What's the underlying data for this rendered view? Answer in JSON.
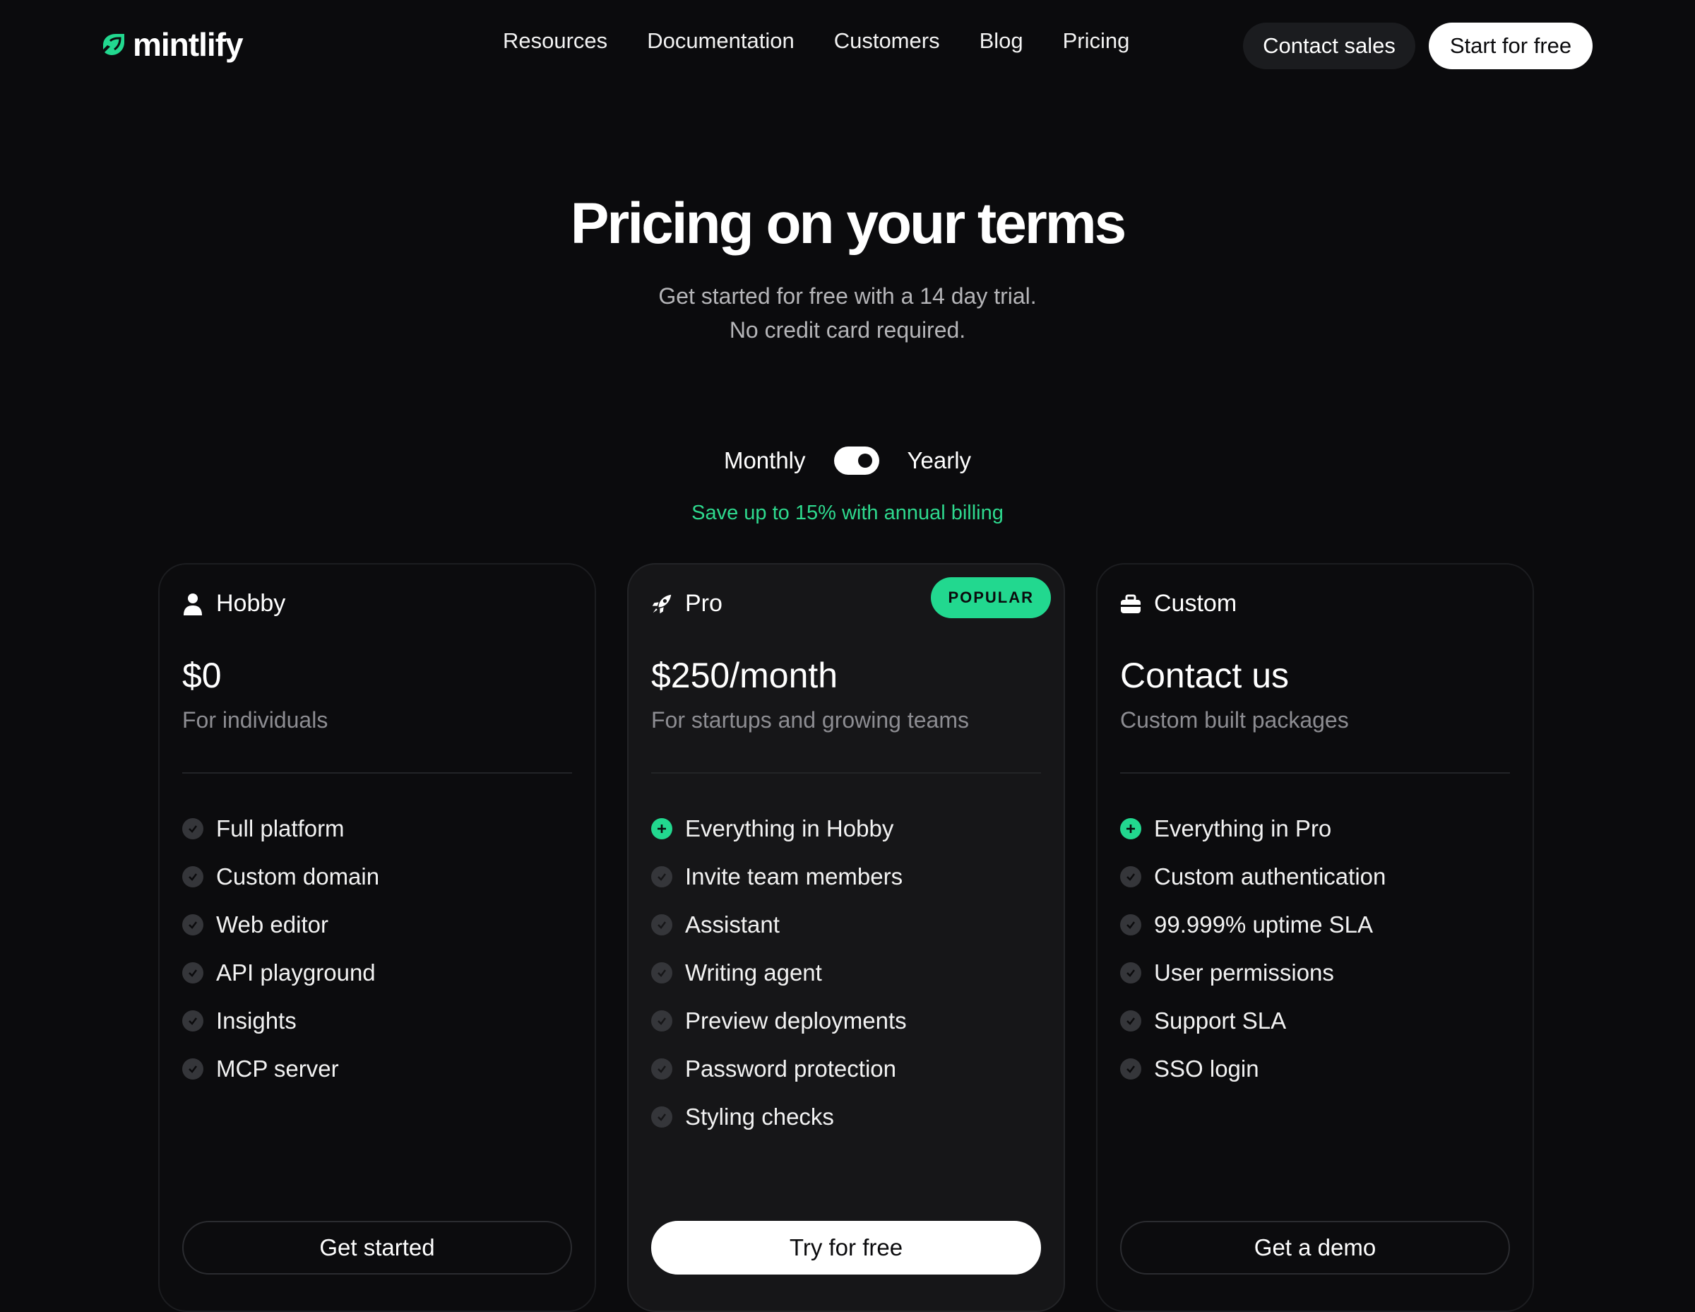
{
  "nav": {
    "logo_text": "mintlify",
    "links": [
      "Resources",
      "Documentation",
      "Customers",
      "Blog",
      "Pricing"
    ],
    "contact_label": "Contact sales",
    "start_label": "Start for free"
  },
  "hero": {
    "title": "Pricing on your terms",
    "subtitle_line1": "Get started for free with a 14 day trial.",
    "subtitle_line2": "No credit card required."
  },
  "billing": {
    "monthly_label": "Monthly",
    "yearly_label": "Yearly",
    "selected": "Yearly",
    "save_note": "Save up to 15% with annual billing"
  },
  "colors": {
    "accent": "#22d88f",
    "background": "#0b0b0d"
  },
  "plans": [
    {
      "name": "Hobby",
      "icon": "user-icon",
      "price": "$0",
      "description": "For individuals",
      "features": [
        {
          "text": "Full platform",
          "icon": "check-icon"
        },
        {
          "text": "Custom domain",
          "icon": "check-icon"
        },
        {
          "text": "Web editor",
          "icon": "check-icon"
        },
        {
          "text": "API playground",
          "icon": "check-icon"
        },
        {
          "text": "Insights",
          "icon": "check-icon"
        },
        {
          "text": "MCP server",
          "icon": "check-icon"
        }
      ],
      "cta": "Get started"
    },
    {
      "name": "Pro",
      "icon": "rocket-icon",
      "badge": "POPULAR",
      "price": "$250/month",
      "description": "For startups and growing teams",
      "features": [
        {
          "text": "Everything in Hobby",
          "icon": "plus-icon"
        },
        {
          "text": "Invite team members",
          "icon": "check-icon"
        },
        {
          "text": "Assistant",
          "icon": "check-icon"
        },
        {
          "text": "Writing agent",
          "icon": "check-icon"
        },
        {
          "text": "Preview deployments",
          "icon": "check-icon"
        },
        {
          "text": "Password protection",
          "icon": "check-icon"
        },
        {
          "text": "Styling checks",
          "icon": "check-icon"
        }
      ],
      "cta": "Try for free"
    },
    {
      "name": "Custom",
      "icon": "briefcase-icon",
      "price": "Contact us",
      "description": "Custom built packages",
      "features": [
        {
          "text": "Everything in Pro",
          "icon": "plus-icon"
        },
        {
          "text": "Custom authentication",
          "icon": "check-icon"
        },
        {
          "text": "99.999% uptime SLA",
          "icon": "check-icon"
        },
        {
          "text": "User permissions",
          "icon": "check-icon"
        },
        {
          "text": "Support SLA",
          "icon": "check-icon"
        },
        {
          "text": "SSO login",
          "icon": "check-icon"
        }
      ],
      "cta": "Get a demo"
    }
  ]
}
